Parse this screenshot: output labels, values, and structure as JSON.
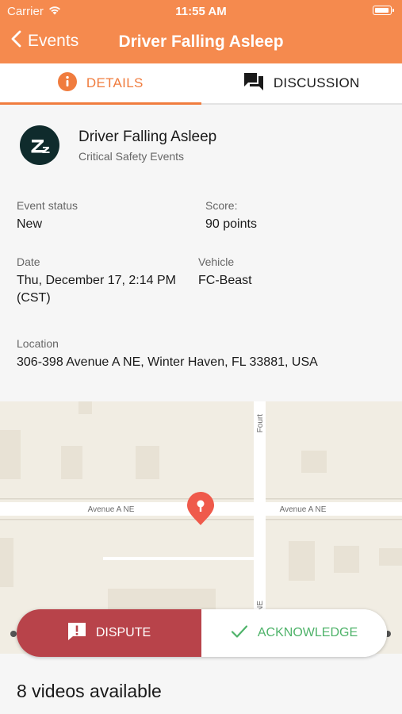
{
  "status_bar": {
    "carrier": "Carrier",
    "time": "11:55 AM"
  },
  "nav": {
    "back_label": "Events",
    "title": "Driver Falling Asleep"
  },
  "tabs": [
    {
      "label": "DETAILS",
      "icon": "info-icon",
      "active": true
    },
    {
      "label": "DISCUSSION",
      "icon": "chat-bubbles-icon",
      "active": false
    }
  ],
  "event": {
    "icon": "sleep-zz-icon",
    "title": "Driver Falling Asleep",
    "category": "Critical Safety Events"
  },
  "fields": {
    "status_label": "Event status",
    "status_value": "New",
    "score_label": "Score:",
    "score_value": "90 points",
    "date_label": "Date",
    "date_value_line1": "Thu, December 17, 2:14 PM",
    "date_value_line2": "(CST)",
    "vehicle_label": "Vehicle",
    "vehicle_value": "FC-Beast",
    "location_label": "Location",
    "location_value": "306-398 Avenue A NE, Winter Haven, FL 33881, USA"
  },
  "map": {
    "street_labels": [
      "Avenue A NE",
      "Avenue A NE",
      "Fourt",
      "NE"
    ],
    "pin_icon": "map-pin-icon"
  },
  "actions": {
    "dispute_label": "DISPUTE",
    "acknowledge_label": "ACKNOWLEDGE"
  },
  "videos_text": "8 videos available",
  "colors": {
    "header_orange": "#f58a4e",
    "accent_orange": "#f07c3e",
    "dispute_red": "#b8434a",
    "acknowledge_green": "#4fb36a",
    "pin_red": "#ef5a4b",
    "icon_dark": "#0f2b2c"
  }
}
